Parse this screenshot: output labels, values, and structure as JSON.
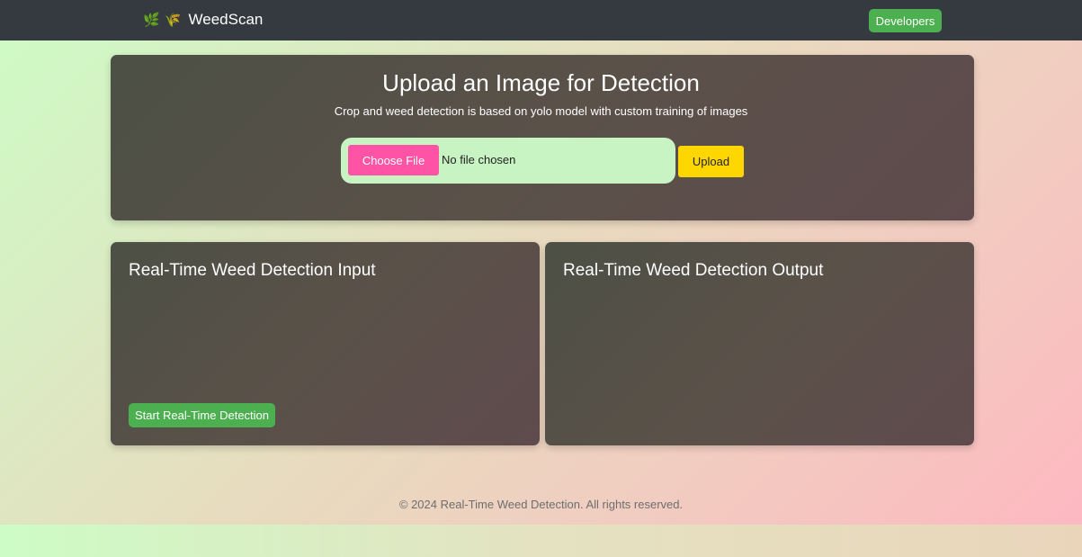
{
  "navbar": {
    "brand_icons": "🌿 🌾",
    "brand_name": "WeedScan",
    "developers_label": "Developers"
  },
  "upload": {
    "title": "Upload an Image for Detection",
    "subtitle": "Crop and weed detection is based on yolo model with custom training of images",
    "choose_file_label": "Choose File",
    "file_status": "No file chosen",
    "upload_label": "Upload"
  },
  "input_panel": {
    "title": "Real-Time Weed Detection Input",
    "start_label": "Start Real-Time Detection"
  },
  "output_panel": {
    "title": "Real-Time Weed Detection Output"
  },
  "footer": {
    "text": "© 2024 Real-Time Weed Detection. All rights reserved."
  },
  "colors": {
    "navbar": "#343a40",
    "green_button": "#4caf50",
    "choose_file": "#ff54a6",
    "upload_button": "#ffd700",
    "file_box": "#c8f3c3"
  }
}
